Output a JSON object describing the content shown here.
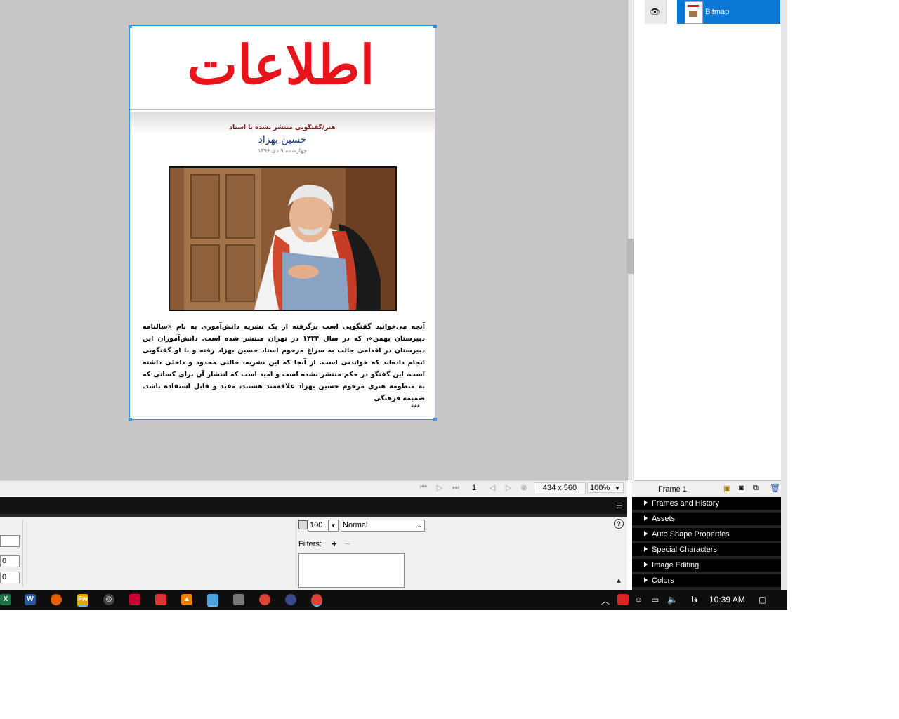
{
  "document": {
    "masthead": "اطلاعات",
    "kicker": "هنر/گفتگویی منتشر نشده با استاد",
    "headline": "حسین بهزاد",
    "dateline": "چهارشنبه ۹ دی ۱۳۹۶",
    "body": "آنچه می‌خوانید گفتگویی است برگرفته از یک نشریه دانش‌آموزی به نام «سالنامه دبیرستان بهمن»، که در سال ۱۳۴۴ در تهران منتشر شده است. دانش‌آموزان این دبیرستان در اقدامی جالب به سراغ مرحوم استاد حسین بهزاد رفته و با او گفتگویی انجام داده‌اند که خواندنی است. از آنجا که این نشریه، حالتی محدود و داخلی داشته است، این گفتگو در حکم منتشر نشده است و امید است که انتشار آن برای کسانی که به منظومه هنری مرحوم حسین بهزاد علاقه‌مند هستند، مفید و قابل استفاده باشد. ضمیمه فرهنگی",
    "stars": "***"
  },
  "statusbar": {
    "frame_number": "1",
    "doc_size": "434 x 560",
    "zoom": "100%"
  },
  "properties": {
    "opacity": "100",
    "blend_mode": "Normal",
    "filters_label": "Filters:",
    "field_2": "0",
    "field_3": "0"
  },
  "layers": {
    "selected_layer_name": "Bitmap"
  },
  "frames": {
    "label": "Frame 1"
  },
  "panels": [
    "Frames and History",
    "Assets",
    "Auto Shape Properties",
    "Special Characters",
    "Image Editing",
    "Colors"
  ],
  "taskbar": {
    "time": "10:39 AM",
    "lang": "فا"
  },
  "colors": {
    "selection": "#21a0f0",
    "layer_selected": "#0a78d7",
    "masthead_red": "#e8141c"
  }
}
